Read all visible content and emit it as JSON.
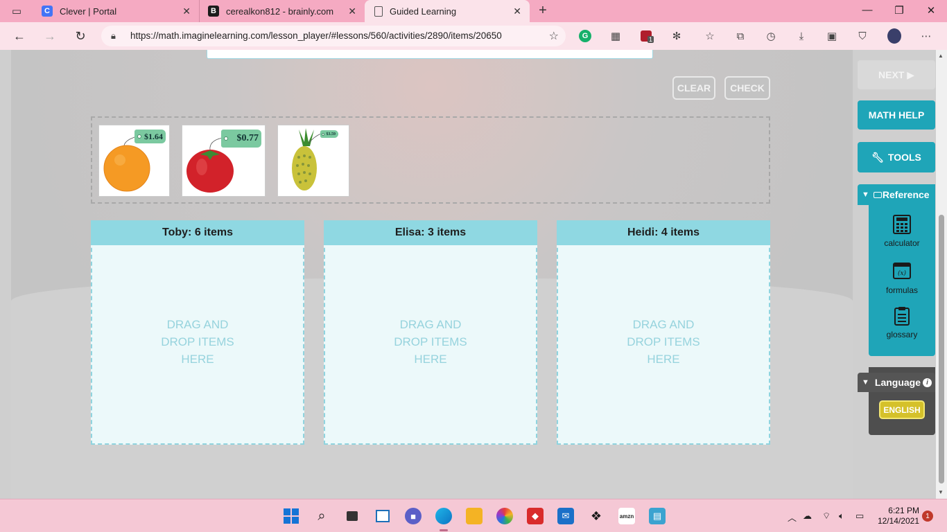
{
  "browser": {
    "tabs": [
      {
        "title": "Clever | Portal",
        "favicon": "C",
        "color": "#4274f6"
      },
      {
        "title": "cerealkon812 - brainly.com",
        "favicon": "B",
        "color": "#1b1b1b"
      },
      {
        "title": "Guided Learning",
        "favicon": "",
        "color": ""
      }
    ],
    "url": "https://math.imaginelearning.com/lesson_player/#lessons/560/activities/2890/items/20650",
    "extension_badge": "1"
  },
  "activity": {
    "clear_label": "CLEAR",
    "check_label": "CHECK",
    "items": [
      {
        "name": "orange",
        "price": "$1.64"
      },
      {
        "name": "tomato",
        "price": "$0.77"
      },
      {
        "name": "pineapple",
        "price": "$3.59"
      }
    ],
    "bins": [
      {
        "title": "Toby: 6 items",
        "drop_text": "DRAG AND DROP ITEMS HERE"
      },
      {
        "title": "Elisa: 3 items",
        "drop_text": "DRAG AND DROP ITEMS HERE"
      },
      {
        "title": "Heidi: 4 items",
        "drop_text": "DRAG AND DROP ITEMS HERE"
      }
    ]
  },
  "rail": {
    "next_label": "NEXT ▶",
    "math_help_label": "MATH HELP",
    "tools_label": "TOOLS",
    "reference_label": "Reference",
    "reference_items": [
      "calculator",
      "formulas",
      "glossary"
    ],
    "language_label": "Language",
    "english_label": "ENGLISH"
  },
  "taskbar": {
    "time": "6:21 PM",
    "date": "12/14/2021",
    "notifications": "1"
  }
}
